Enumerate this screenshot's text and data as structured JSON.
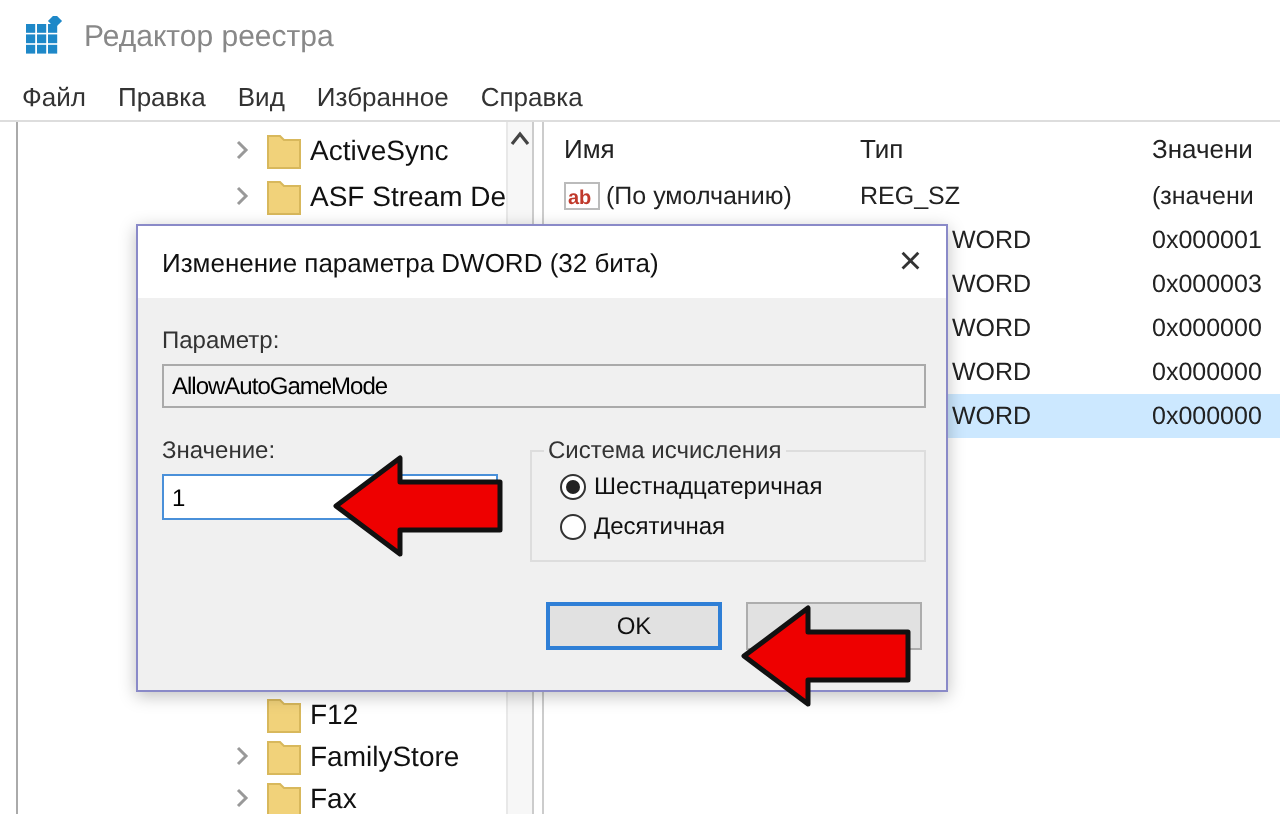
{
  "window": {
    "title": "Редактор реестра"
  },
  "menu": [
    "Файл",
    "Правка",
    "Вид",
    "Избранное",
    "Справка"
  ],
  "tree": {
    "top_items": [
      {
        "label": "ActiveSync",
        "expandable": true
      },
      {
        "label": "ASF Stream De",
        "expandable": true
      }
    ],
    "bottom_items": [
      {
        "label": "F12",
        "expandable": false
      },
      {
        "label": "FamilyStore",
        "expandable": true
      },
      {
        "label": "Fax",
        "expandable": true
      }
    ]
  },
  "list": {
    "columns": [
      "Имя",
      "Тип",
      "Значени"
    ],
    "rows": [
      {
        "name": "(По умолчанию)",
        "icon_text": "ab",
        "type": "REG_SZ",
        "value": "(значени",
        "selected": false
      },
      {
        "type": "WORD",
        "value": "0x000001",
        "selected": false
      },
      {
        "type": "WORD",
        "value": "0x000003",
        "selected": false
      },
      {
        "type": "WORD",
        "value": "0x000000",
        "selected": false
      },
      {
        "type": "WORD",
        "value": "0x000000",
        "selected": false
      },
      {
        "type": "WORD",
        "value": "0x000000",
        "selected": true
      }
    ]
  },
  "dialog": {
    "title": "Изменение параметра DWORD (32 бита)",
    "close": "×",
    "param_label": "Параметр:",
    "param_value": "AllowAutoGameMode",
    "value_label": "Значение:",
    "value": "1",
    "group_label": "Система исчисления",
    "radios": [
      {
        "label": "Шестнадцатеричная",
        "selected": true
      },
      {
        "label": "Десятичная",
        "selected": false
      }
    ],
    "ok": "OK"
  }
}
